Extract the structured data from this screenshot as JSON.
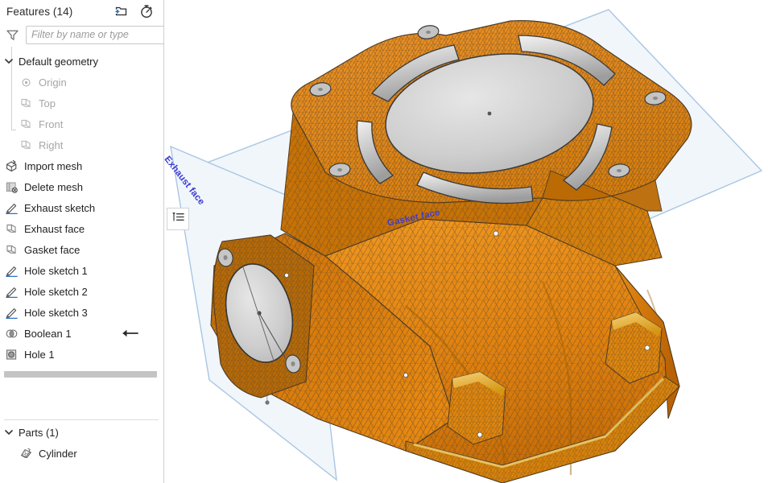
{
  "panel": {
    "title": "Features (14)",
    "header_icons": [
      {
        "name": "new-folder-icon",
        "label": "New folder"
      },
      {
        "name": "history-timer-icon",
        "label": "Feature history"
      }
    ],
    "filter": {
      "icon": "funnel-icon",
      "placeholder": "Filter by name or type",
      "value": ""
    },
    "tree": [
      {
        "label": "Default geometry",
        "icon": "chevron-down-icon",
        "type": "group",
        "expanded": true,
        "dim": false
      },
      {
        "label": "Origin",
        "icon": "origin-point-icon",
        "type": "child",
        "dim": true
      },
      {
        "label": "Top",
        "icon": "plane-icon",
        "type": "child",
        "dim": true
      },
      {
        "label": "Front",
        "icon": "plane-icon",
        "type": "child",
        "dim": true
      },
      {
        "label": "Right",
        "icon": "plane-icon",
        "type": "child",
        "dim": true
      },
      {
        "label": "Import mesh",
        "icon": "import-mesh-icon",
        "type": "feature",
        "dim": false
      },
      {
        "label": "Delete mesh",
        "icon": "delete-mesh-icon",
        "type": "feature",
        "dim": false
      },
      {
        "label": "Exhaust sketch",
        "icon": "sketch-pencil-icon",
        "type": "feature",
        "dim": false
      },
      {
        "label": "Exhaust face",
        "icon": "plane-icon",
        "type": "feature",
        "dim": false
      },
      {
        "label": "Gasket face",
        "icon": "plane-icon",
        "type": "feature",
        "dim": false
      },
      {
        "label": "Hole sketch 1",
        "icon": "sketch-pencil-icon",
        "type": "feature",
        "dim": false
      },
      {
        "label": "Hole sketch 2",
        "icon": "sketch-pencil-icon",
        "type": "feature",
        "dim": false
      },
      {
        "label": "Hole sketch 3",
        "icon": "sketch-pencil-icon",
        "type": "feature",
        "dim": false
      },
      {
        "label": "Boolean 1",
        "icon": "boolean-icon",
        "type": "feature",
        "dim": false,
        "arrow": true
      },
      {
        "label": "Hole 1",
        "icon": "hole-icon",
        "type": "feature",
        "dim": false
      }
    ],
    "rollback": {
      "name": "rollback-bar"
    },
    "parts": {
      "title": "Parts (1)",
      "chevron": "chevron-down-icon",
      "items": [
        {
          "label": "Cylinder",
          "icon": "part-solid-icon"
        }
      ]
    }
  },
  "viewport": {
    "panel_toggle": {
      "name": "feature-list-toggle",
      "icon": "list-outline-icon"
    },
    "plane_labels": [
      {
        "id": "exhaust",
        "text": "Exhaust face"
      },
      {
        "id": "gasket",
        "text": "Gasket face"
      }
    ],
    "model": {
      "name": "Cylinder",
      "mesh_color": "#e08214",
      "mesh_color_dark": "#9a5a0d",
      "mesh_wire_color": "#5c4a33",
      "cad_face_color": "#d6d6d6",
      "plane_fill": "#f1f6fb",
      "plane_stroke": "#a9c6e3"
    }
  },
  "colors": {
    "accent_blue": "#1a6fd4",
    "label_blue": "#3a3ad4",
    "text_primary": "#222222",
    "text_dim": "#a6a6a6",
    "border": "#cfcfcf",
    "rollback": "#c4c4c4"
  }
}
